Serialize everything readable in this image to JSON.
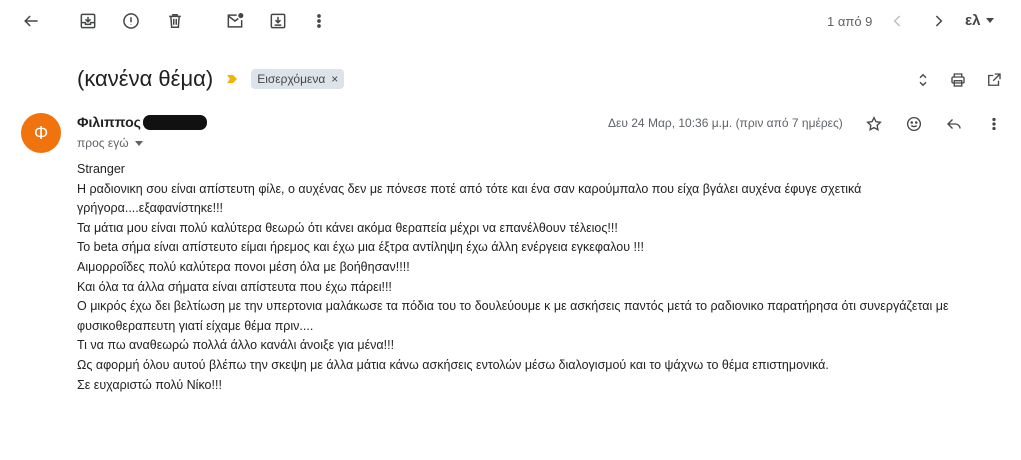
{
  "toolbar": {
    "icons": [
      "back-arrow-icon",
      "archive-icon",
      "report-spam-icon",
      "delete-icon",
      "mark-unread-icon",
      "move-to-icon",
      "more-vert-icon"
    ],
    "pager": "1 από 9",
    "language": "ελ"
  },
  "message": {
    "subject": "(κανένα θέμα)",
    "label": "Εισερχόμενα",
    "label_remove": "×",
    "sender_initial": "Φ",
    "sender_name": "Φιλιππος",
    "recipient": "προς εγώ",
    "date": "Δευ 24 Μαρ, 10:36 μ.μ. (πριν από 7 ημέρες)",
    "body_lines": [
      "Stranger",
      "Η ραδιονικη σου είναι απίστευτη φίλε, ο αυχένας δεν με πόνεσε ποτέ από τότε και ένα σαν καρούμπαλο που είχα βγάλει αυχένα έφυγε σχετικά γρήγορα....εξαφανίστηκε!!!",
      "Τα μάτια μου είναι πολύ καλύτερα θεωρώ ότι κάνει ακόμα θεραπεία μέχρι να επανέλθουν τέλειος!!!",
      "Το beta σήμα είναι απίστευτο είμαι ήρεμος και έχω μια έξτρα αντίληψη έχω άλλη ενέργεια εγκεφαλου !!!",
      "Αιμορροΐδες πολύ καλύτερα πονοι μέση όλα με βοήθησαν!!!!",
      "Και όλα τα άλλα  σήματα είναι απίστευτα που έχω πάρει!!!",
      "Ο μικρός έχω δει βελτίωση με την υπερτονια μαλάκωσε τα πόδια του το δουλεύουμε κ με ασκήσεις παντός μετά το ραδιονικο παρατήρησα ότι συνεργάζεται με φυσικοθεραπευτη γιατί είχαμε θέμα πριν....",
      "Τι να πω αναθεωρώ πολλά άλλο κανάλι άνοιξε για μένα!!!",
      "Ως αφορμή όλου αυτού βλέπω την σκεψη με άλλα μάτια κάνω ασκήσεις εντολών μέσω διαλογισμού και το ψάχνω το θέμα επιστημονικά.",
      "Σε ευχαριστώ πολύ Νίκο!!!"
    ]
  },
  "colors": {
    "avatar": "#f1730d",
    "chip": "#dde3ea",
    "marker": "#f4b400"
  }
}
